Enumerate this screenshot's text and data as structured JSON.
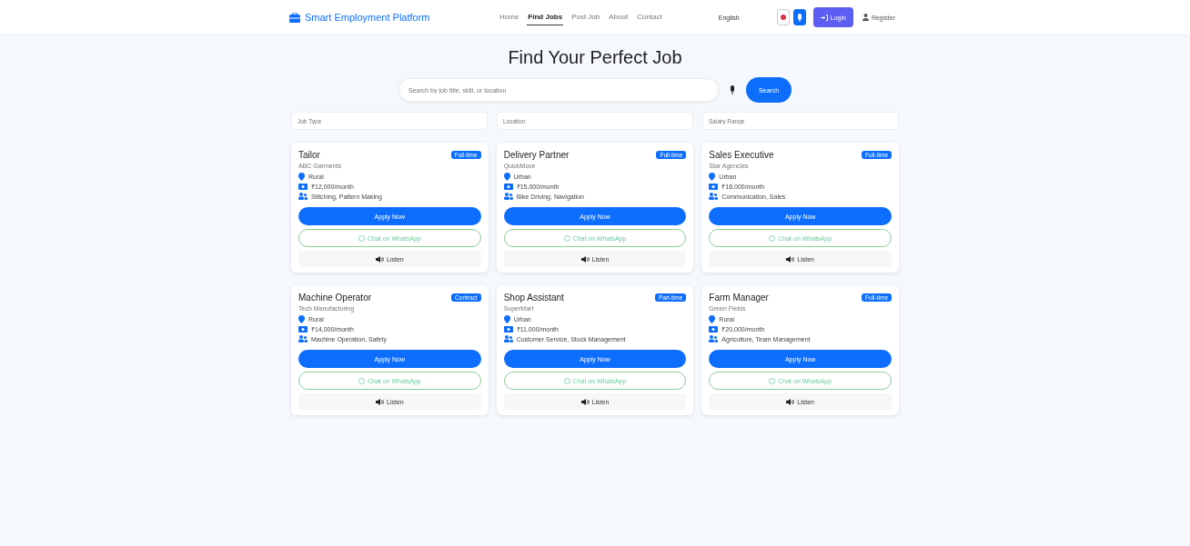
{
  "brand": "Smart Employment Platform",
  "nav": [
    {
      "label": "Home",
      "selected": false
    },
    {
      "label": "Find Jobs",
      "selected": true
    },
    {
      "label": "Post Job",
      "selected": false
    },
    {
      "label": "About",
      "selected": false
    },
    {
      "label": "Contact",
      "selected": false
    }
  ],
  "language": "English",
  "login": "Login",
  "register": "Register",
  "title": "Find Your Perfect Job",
  "search": {
    "placeholder": "Search by job title, skill, or location",
    "button": "Search"
  },
  "filters": [
    {
      "placeholder": "Job Type"
    },
    {
      "placeholder": "Location"
    },
    {
      "placeholder": "Salary Range"
    }
  ],
  "jobs": [
    {
      "title": "Tailor",
      "badge": "Full-time",
      "company": "ABC Garments",
      "location": "Rural",
      "salary": "₹12,000/month",
      "skills": "Stitching, Pattern Making",
      "apply": "Apply Now",
      "chat": "Chat on WhatsApp",
      "listen": "Listen"
    },
    {
      "title": "Delivery Partner",
      "badge": "Full-time",
      "company": "QuickMove",
      "location": "Urban",
      "salary": "₹15,000/month",
      "skills": "Bike Driving, Navigation",
      "apply": "Apply Now",
      "chat": "Chat on WhatsApp",
      "listen": "Listen"
    },
    {
      "title": "Sales Executive",
      "badge": "Full-time",
      "company": "Star Agencies",
      "location": "Urban",
      "salary": "₹18,000/month",
      "skills": "Communication, Sales",
      "apply": "Apply Now",
      "chat": "Chat on WhatsApp",
      "listen": "Listen"
    },
    {
      "title": "Machine Operator",
      "badge": "Contract",
      "company": "Tech Manufacturing",
      "location": "Rural",
      "salary": "₹14,000/month",
      "skills": "Machine Operation, Safety",
      "apply": "Apply Now",
      "chat": "Chat on WhatsApp",
      "listen": "Listen"
    },
    {
      "title": "Shop Assistant",
      "badge": "Part-time",
      "company": "SuperMart",
      "location": "Urban",
      "salary": "₹11,000/month",
      "skills": "Customer Service, Stock Management",
      "apply": "Apply Now",
      "chat": "Chat on WhatsApp",
      "listen": "Listen"
    },
    {
      "title": "Farm Manager",
      "badge": "Full-time",
      "company": "Green Fields",
      "location": "Rural",
      "salary": "₹20,000/month",
      "skills": "Agriculture, Team Management",
      "apply": "Apply Now",
      "chat": "Chat on WhatsApp",
      "listen": "Listen"
    }
  ]
}
